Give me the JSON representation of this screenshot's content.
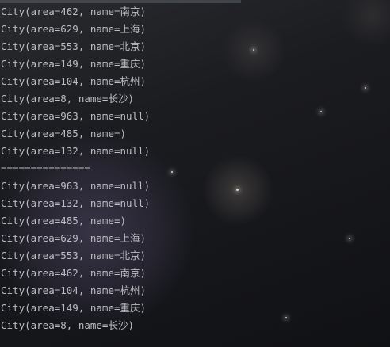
{
  "console": {
    "lines": [
      "City(area=462, name=南京)",
      "City(area=629, name=上海)",
      "City(area=553, name=北京)",
      "City(area=149, name=重庆)",
      "City(area=104, name=杭州)",
      "City(area=8, name=长沙)",
      "City(area=963, name=null)",
      "City(area=485, name=)",
      "City(area=132, name=null)",
      "===============",
      "City(area=963, name=null)",
      "City(area=132, name=null)",
      "City(area=485, name=)",
      "City(area=629, name=上海)",
      "City(area=553, name=北京)",
      "City(area=462, name=南京)",
      "City(area=104, name=杭州)",
      "City(area=149, name=重庆)",
      "City(area=8, name=长沙)"
    ],
    "text_color": "#bcbec4"
  }
}
